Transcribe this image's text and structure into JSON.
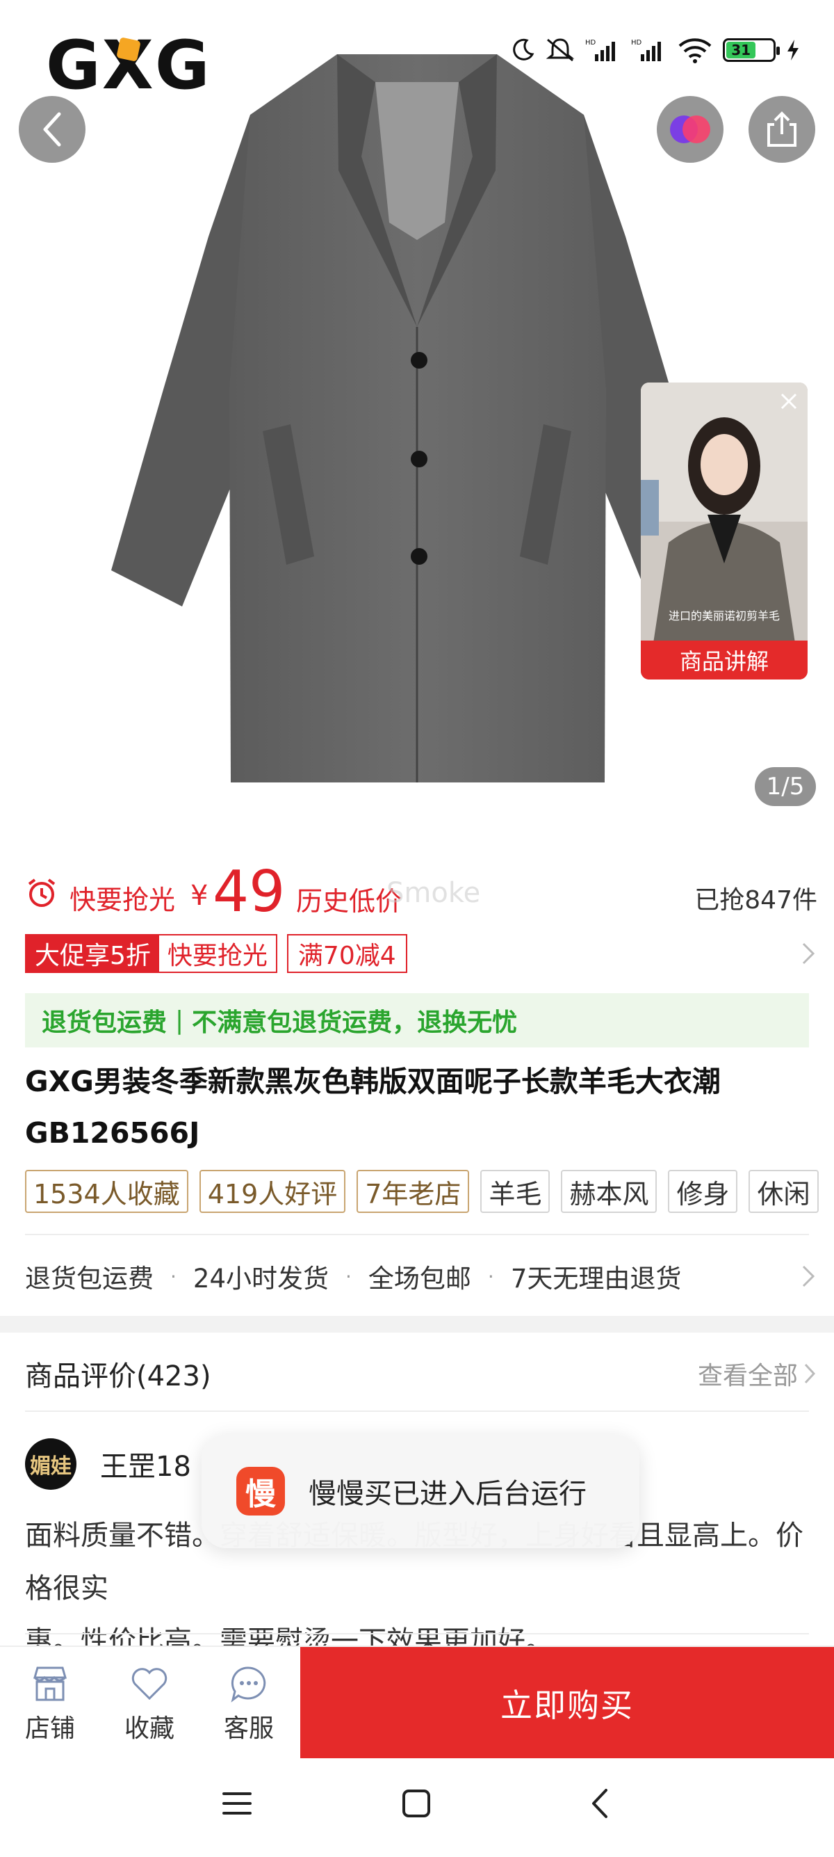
{
  "status_bar": {
    "battery": "31"
  },
  "brand": {
    "logo_text": "GXG"
  },
  "hero": {
    "image_counter": "1/5"
  },
  "video_card": {
    "caption": "进口的美丽诺初剪羊毛",
    "label": "商品讲解"
  },
  "price": {
    "hurry_label": "快要抢光",
    "currency": "¥",
    "value": "49",
    "history_label": "历史低价",
    "watermark": "Smoke",
    "sold": "已抢847件"
  },
  "promo": {
    "main_left": "大促享5折",
    "main_right": "快要抢光",
    "coupon": "满70减4"
  },
  "return_banner": {
    "left": "退货包运费",
    "separator": "|",
    "right": "不满意包退货运费，退换无忧"
  },
  "product": {
    "title_line1": "GXG男装冬季新款黑灰色韩版双面呢子长款羊毛大衣潮",
    "title_line2": "GB126566J"
  },
  "tags": {
    "gold": [
      "1534人收藏",
      "419人好评",
      "7年老店"
    ],
    "gray": [
      "羊毛",
      "赫本风",
      "修身",
      "休闲"
    ]
  },
  "services": {
    "items": [
      "退货包运费",
      "24小时发货",
      "全场包邮",
      "7天无理由退货"
    ],
    "separator": "·"
  },
  "reviews": {
    "title": "商品评价(423)",
    "view_all": "查看全部",
    "user_name": "王罡18",
    "avatar_text": "媚娃",
    "text_line1": "面料质量不错。穿着舒适保暖。版型好，上身好看且显高上。价格很实",
    "text_line2": "惠。性价比高。需要熨烫一下效果更加好。"
  },
  "toast": {
    "icon_text": "慢",
    "message": "慢慢买已进入后台运行"
  },
  "bottom_bar": {
    "shop": "店铺",
    "favorite": "收藏",
    "service": "客服",
    "buy": "立即购买"
  },
  "colors": {
    "accent_red": "#e0222a",
    "buy_red": "#e52a2a",
    "green": "#2aa52e",
    "gold_tag": "#c9a571"
  }
}
